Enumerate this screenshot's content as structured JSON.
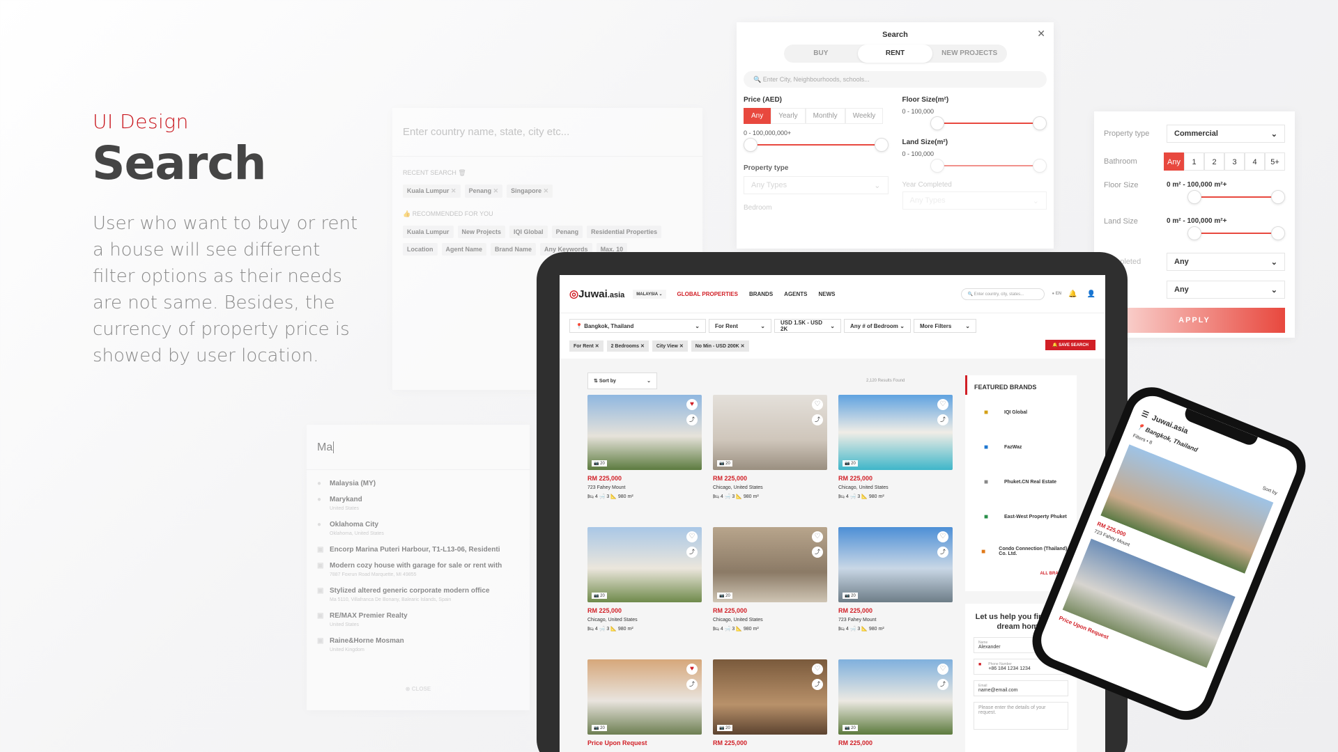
{
  "hero": {
    "kicker": "UI Design",
    "title": "Search",
    "description": "User who want to buy or rent a house will see different filter options as their needs are not same. Besides, the currency of property price is showed by user location."
  },
  "search_panel": {
    "placeholder": "Enter country name, state, city etc...",
    "recent_label": "RECENT SEARCH",
    "recent": [
      "Kuala Lumpur",
      "Penang",
      "Singapore"
    ],
    "recommended_label": "RECOMMENDED FOR YOU",
    "recommended": [
      "Kuala Lumpur",
      "New Projects",
      "IQI Global",
      "Penang",
      "Residential Properties",
      "Location",
      "Agent Name",
      "Brand Name",
      "Any Keywords",
      "Max. 10"
    ]
  },
  "filter_modal": {
    "title": "Search",
    "tabs": [
      "BUY",
      "RENT",
      "NEW PROJECTS"
    ],
    "active_tab": "RENT",
    "search_placeholder": "Enter City, Neighbourhoods, schools...",
    "price_label": "Price (AED)",
    "price_periods": [
      "Any",
      "Yearly",
      "Monthly",
      "Weekly"
    ],
    "price_range": "0 - 100,000,000+",
    "floor_label": "Floor Size(m²)",
    "floor_range": "0 - 100,000",
    "land_label": "Land Size(m²)",
    "land_range": "0 - 100,000",
    "property_type_label": "Property type",
    "property_type_value": "Any Types",
    "bedroom_label": "Bedroom",
    "year_label": "Year Completed",
    "year_value": "Any Types"
  },
  "filter_side": {
    "property_type_label": "Property type",
    "property_type_value": "Commercial",
    "bathroom_label": "Bathroom",
    "bathroom_options": [
      "Any",
      "1",
      "2",
      "3",
      "4",
      "5+"
    ],
    "floor_label": "Floor Size",
    "floor_value": "0 m² - 100,000 m²+",
    "land_label": "Land Size",
    "land_value": "0 m² - 100,000 m²+",
    "completed_label": "Completed",
    "completed_value": "Any",
    "extra_value": "Any",
    "apply_label": "APPLY"
  },
  "autocomplete": {
    "query": "Ma",
    "close_label": "CLOSE",
    "results": [
      {
        "title": "Malaysia (MY)",
        "sub": ""
      },
      {
        "title": "Marykand",
        "sub": "United States"
      },
      {
        "title": "Oklahoma City",
        "sub": "Oklahoma, United States"
      },
      {
        "title": "Encorp Marina Puteri Harbour, T1-L13-06, Residenti",
        "sub": ""
      },
      {
        "title": "Modern cozy house with garage for sale or rent with",
        "sub": "7887 Foxrun Road Marquette, MI 49855"
      },
      {
        "title": "Stylized altered generic corporate modern office",
        "sub": "Ma 5110, Villafranca De Bonany, Balearic Islands, Spain"
      },
      {
        "title": "RE/MAX Premier Realty",
        "sub": "United States"
      },
      {
        "title": "Raine&Horne Mosman",
        "sub": "United Kingdom"
      }
    ]
  },
  "site": {
    "logo_main": "Juwai",
    "logo_suffix": ".asia",
    "country": "MALAYSIA",
    "nav": [
      "GLOBAL PROPERTIES",
      "BRANDS",
      "AGENTS",
      "NEWS"
    ],
    "search_placeholder": "Enter country, city, states...",
    "lang": "EN",
    "location": "Bangkok, Thailand",
    "type": "For Rent",
    "price": "USD 1.5K - USD 2K",
    "bedroom": "Any # of Bedroom",
    "more": "More Filters",
    "chips": [
      "For Rent",
      "2 Bedrooms",
      "City View",
      "No Min - USD 200K"
    ],
    "save_search": "SAVE SEARCH",
    "sort_label": "Sort by",
    "results_count": "2,120 Results Found",
    "featured_title": "FEATURED BRANDS",
    "brands": [
      "IQI Global",
      "FazWaz",
      "Phuket.CN Real Estate",
      "East-West Property Phuket",
      "Condo Connection (Thailand) Co. Ltd."
    ],
    "all_brands": "ALL BRANDS",
    "help_title": "Let us help you find your dream home!",
    "help_name_label": "Name",
    "help_name": "Alexander",
    "help_phone_label": "Phone Number",
    "help_phone": "+86 184 1234 1234",
    "help_email_label": "Email",
    "help_email": "name@email.com",
    "help_msg": "Please enter the details of your request."
  },
  "listings": [
    {
      "price": "RM 225,000",
      "addr": "723 Fahey Mount",
      "beds": "4",
      "baths": "3",
      "size": "980 m²",
      "count": "20",
      "fav": true
    },
    {
      "price": "RM 225,000",
      "addr": "Chicago, United States",
      "beds": "4",
      "baths": "3",
      "size": "980 m²",
      "count": "20",
      "fav": false
    },
    {
      "price": "RM 225,000",
      "addr": "Chicago, United States",
      "beds": "4",
      "baths": "3",
      "size": "980 m²",
      "count": "20",
      "fav": false
    },
    {
      "price": "RM 225,000",
      "addr": "Chicago, United States",
      "beds": "4",
      "baths": "3",
      "size": "980 m²",
      "count": "20",
      "fav": false
    },
    {
      "price": "RM 225,000",
      "addr": "Chicago, United States",
      "beds": "4",
      "baths": "3",
      "size": "980 m²",
      "count": "20",
      "fav": false
    },
    {
      "price": "RM 225,000",
      "addr": "723 Fahey Mount",
      "beds": "4",
      "baths": "3",
      "size": "980 m²",
      "count": "20",
      "fav": false
    },
    {
      "price": "Price Upon Request",
      "addr": "",
      "beds": "",
      "baths": "",
      "size": "",
      "count": "20",
      "fav": true
    },
    {
      "price": "RM 225,000",
      "addr": "",
      "beds": "",
      "baths": "",
      "size": "",
      "count": "20",
      "fav": false
    },
    {
      "price": "RM 225,000",
      "addr": "",
      "beds": "",
      "baths": "",
      "size": "",
      "count": "20",
      "fav": false
    }
  ],
  "phone": {
    "logo": "Juwai.asia",
    "location": "Bangkok, Thailand",
    "filters": "Filters • 8",
    "sort": "Sort by",
    "price1": "RM 225,000",
    "addr1": "723 Fahey Mount",
    "price2": "Price Upon Request"
  },
  "colors": {
    "accent": "#d11f26",
    "accent_light": "#e8483e"
  }
}
